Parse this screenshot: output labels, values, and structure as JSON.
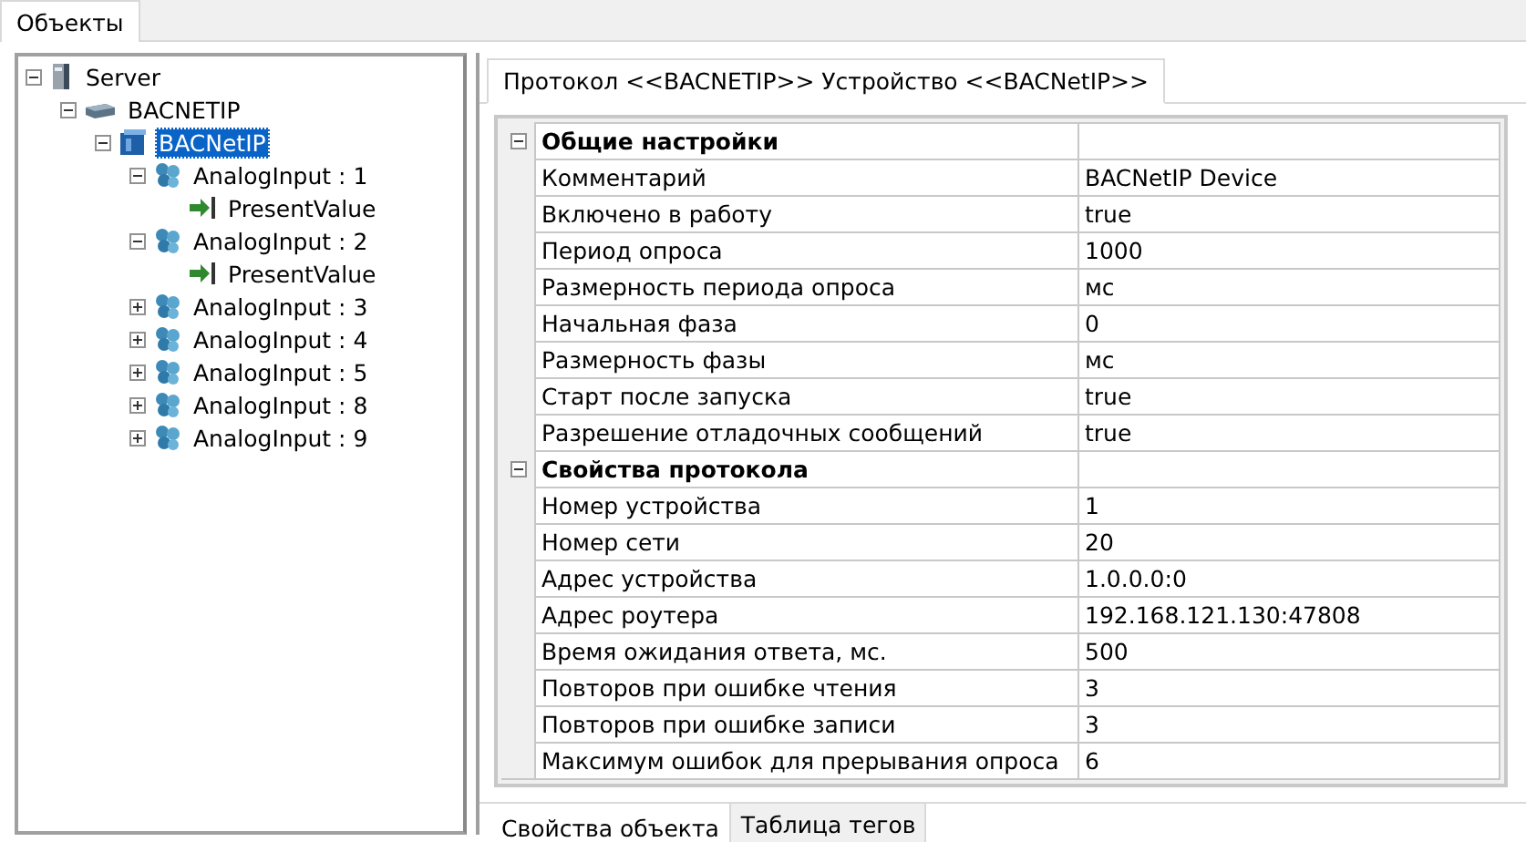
{
  "top_tabs": [
    {
      "label": "Объекты",
      "selected": true
    }
  ],
  "tree": [
    {
      "label": "Server",
      "kind": "server",
      "expanded": true,
      "selected": false,
      "children": [
        {
          "label": "BACNETIP",
          "kind": "bus",
          "expanded": true,
          "selected": false,
          "children": [
            {
              "label": "BACNetIP",
              "kind": "device",
              "expanded": true,
              "selected": true,
              "children": [
                {
                  "label": "AnalogInput : 1",
                  "kind": "object",
                  "expanded": true,
                  "selected": false,
                  "children": [
                    {
                      "label": "PresentValue",
                      "kind": "value",
                      "selected": false
                    }
                  ]
                },
                {
                  "label": "AnalogInput : 2",
                  "kind": "object",
                  "expanded": true,
                  "selected": false,
                  "children": [
                    {
                      "label": "PresentValue",
                      "kind": "value",
                      "selected": false
                    }
                  ]
                },
                {
                  "label": "AnalogInput : 3",
                  "kind": "object",
                  "expanded": false,
                  "selected": false
                },
                {
                  "label": "AnalogInput : 4",
                  "kind": "object",
                  "expanded": false,
                  "selected": false
                },
                {
                  "label": "AnalogInput : 5",
                  "kind": "object",
                  "expanded": false,
                  "selected": false
                },
                {
                  "label": "AnalogInput : 8",
                  "kind": "object",
                  "expanded": false,
                  "selected": false
                },
                {
                  "label": "AnalogInput : 9",
                  "kind": "object",
                  "expanded": false,
                  "selected": false
                }
              ]
            }
          ]
        }
      ]
    }
  ],
  "panel_tabs": [
    {
      "label": "Протокол <<BACNETIP>> Устройство <<BACNetIP>>",
      "selected": true
    }
  ],
  "property_grid": [
    {
      "title": "Общие настройки",
      "expanded": true,
      "rows": [
        {
          "name": "Комментарий",
          "value": "BACNetIP Device"
        },
        {
          "name": "Включено в работу",
          "value": "true"
        },
        {
          "name": "Период опроса",
          "value": "1000"
        },
        {
          "name": "Размерность периода опроса",
          "value": "мс"
        },
        {
          "name": "Начальная фаза",
          "value": "0"
        },
        {
          "name": "Размерность фазы",
          "value": "мс"
        },
        {
          "name": "Старт после запуска",
          "value": "true"
        },
        {
          "name": "Разрешение отладочных сообщений",
          "value": "true"
        }
      ]
    },
    {
      "title": "Свойства протокола",
      "expanded": true,
      "rows": [
        {
          "name": "Номер устройства",
          "value": "1"
        },
        {
          "name": "Номер сети",
          "value": "20"
        },
        {
          "name": "Адрес устройства",
          "value": "1.0.0.0:0"
        },
        {
          "name": "Адрес роутера",
          "value": "192.168.121.130:47808"
        },
        {
          "name": "Время ожидания ответа, мс.",
          "value": "500"
        },
        {
          "name": "Повторов при ошибке чтения",
          "value": "3"
        },
        {
          "name": "Повторов при ошибке записи",
          "value": "3"
        },
        {
          "name": "Максимум ошибок для прерывания опроса",
          "value": "6"
        }
      ]
    }
  ],
  "bottom_tabs": [
    {
      "label": "Свойства объекта",
      "selected": true
    },
    {
      "label": "Таблица тегов",
      "selected": false
    }
  ]
}
